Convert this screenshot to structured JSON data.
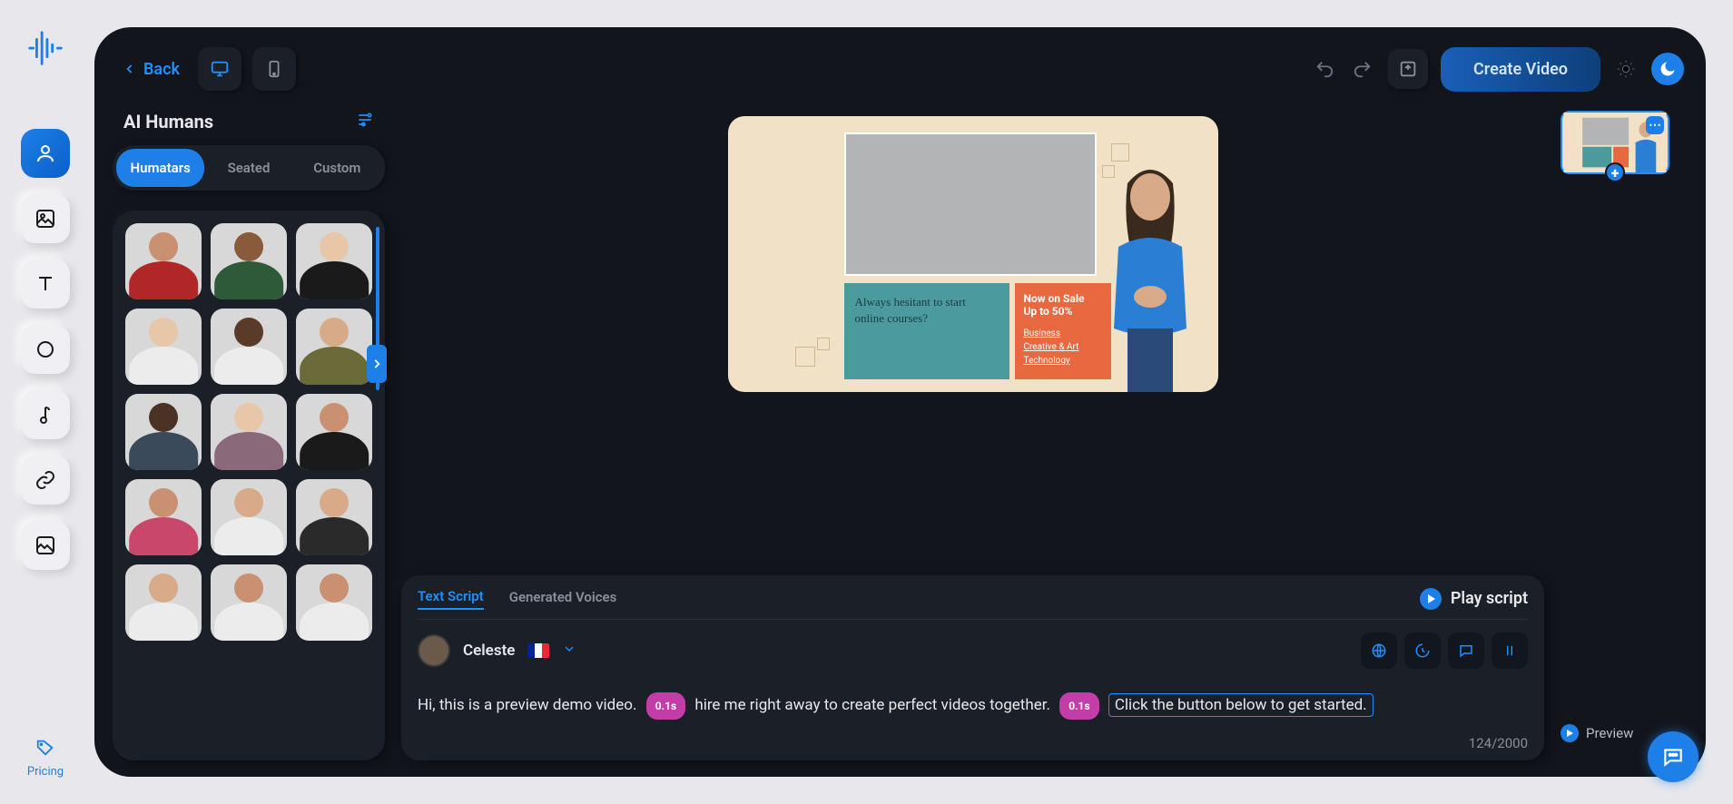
{
  "topbar": {
    "back_label": "Back",
    "create_video_label": "Create Video"
  },
  "sidebar": {
    "title": "AI Humans",
    "tabs": {
      "humatars": "Humatars",
      "seated": "Seated",
      "custom": "Custom"
    }
  },
  "rail": {
    "pricing_label": "Pricing"
  },
  "canvas": {
    "teal_text": "Always hesitant to start online courses?",
    "orange_title_1": "Now on Sale",
    "orange_title_2": "Up to 50%",
    "orange_link_1": "Business",
    "orange_link_2": "Creative & Art",
    "orange_link_3": "Technology"
  },
  "script": {
    "tab_text": "Text Script",
    "tab_voices": "Generated Voices",
    "play_label": "Play script",
    "voice_name": "Celeste",
    "seg1": "Hi, this is a preview demo video.",
    "pause1": "0.1s",
    "seg2": "hire me right away to create perfect videos together.",
    "pause2": "0.1s",
    "seg3": "Click the button below to get started.",
    "char_count": "124/2000"
  },
  "scenes": {
    "preview_label": "Preview"
  },
  "avatar_colors": [
    {
      "skin": "#c99172",
      "shirt": "#b12727",
      "bg": "#d8d8d8"
    },
    {
      "skin": "#8a5a3d",
      "shirt": "#2f5a3a",
      "bg": "#d8d8d8"
    },
    {
      "skin": "#e8c6a8",
      "shirt": "#1a1a1a",
      "bg": "#d8d8d8"
    },
    {
      "skin": "#e8c6a8",
      "shirt": "#ececec",
      "bg": "#d8d8d8"
    },
    {
      "skin": "#5a3b28",
      "shirt": "#ececec",
      "bg": "#d8d8d8"
    },
    {
      "skin": "#d9aa88",
      "shirt": "#6b6b3a",
      "bg": "#d8d8d8"
    },
    {
      "skin": "#4a3224",
      "shirt": "#3a4a5a",
      "bg": "#d8d8d8"
    },
    {
      "skin": "#e8c6a8",
      "shirt": "#8a6a7a",
      "bg": "#d8d8d8"
    },
    {
      "skin": "#c99172",
      "shirt": "#1a1a1a",
      "bg": "#d8d8d8"
    },
    {
      "skin": "#c99172",
      "shirt": "#c9486a",
      "bg": "#d8d8d8"
    },
    {
      "skin": "#d9aa88",
      "shirt": "#ececec",
      "bg": "#d8d8d8"
    },
    {
      "skin": "#d9aa88",
      "shirt": "#2a2a2a",
      "bg": "#d8d8d8"
    },
    {
      "skin": "#d9aa88",
      "shirt": "#ececec",
      "bg": "#d8d8d8"
    },
    {
      "skin": "#c99172",
      "shirt": "#ececec",
      "bg": "#d8d8d8"
    },
    {
      "skin": "#c99172",
      "shirt": "#ececec",
      "bg": "#d8d8d8"
    }
  ]
}
